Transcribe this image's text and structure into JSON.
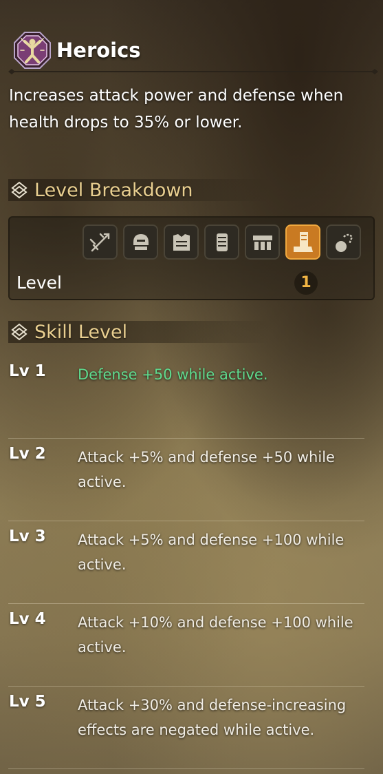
{
  "skill": {
    "name": "Heroics",
    "icon": "heroics-emblem-icon",
    "description": "Increases attack power and defense when health drops to 35% or lower."
  },
  "level_breakdown": {
    "header": "Level Breakdown",
    "equipment_icons": [
      "weapon-icon",
      "helm-icon",
      "chest-icon",
      "arms-icon",
      "waist-icon",
      "legs-icon",
      "talisman-icon"
    ],
    "active_slot": "legs-icon",
    "row_label": "Level",
    "value": "1"
  },
  "skill_levels": {
    "header": "Skill Level",
    "levels": [
      {
        "label": "Lv 1",
        "text": "Defense +50 while active.",
        "current": true
      },
      {
        "label": "Lv 2",
        "text": "Attack +5% and defense +50 while active.",
        "current": false
      },
      {
        "label": "Lv 3",
        "text": "Attack +5% and defense +100 while active.",
        "current": false
      },
      {
        "label": "Lv 4",
        "text": "Attack +10% and defense +100 while active.",
        "current": false
      },
      {
        "label": "Lv 5",
        "text": "Attack +30% and defense-increasing effects are negated while active.",
        "current": false
      }
    ]
  },
  "colors": {
    "current_level": "#5fdc8f",
    "section_header": "#e9cf90",
    "level_value": "#f2b544",
    "active_slot": "#c97a22"
  }
}
